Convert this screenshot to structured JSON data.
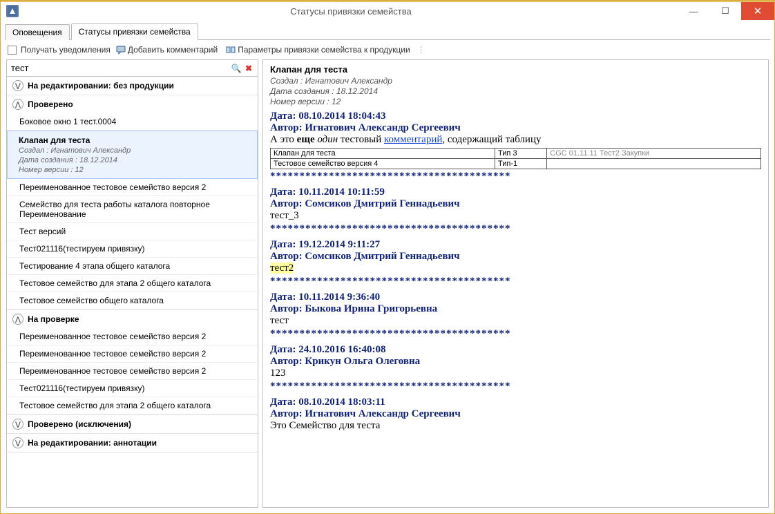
{
  "window": {
    "title": "Статусы привязки семейства"
  },
  "tabs": [
    {
      "label": "Оповещения",
      "active": false
    },
    {
      "label": "Статусы привязки семейства",
      "active": true
    }
  ],
  "toolbar": {
    "receive": "Получать уведомления",
    "comment": "Добавить комментарий",
    "params": "Параметры привязки семейства к продукции"
  },
  "search": {
    "value": "тест"
  },
  "groups": [
    {
      "title": "На редактировании: без продукции",
      "expanded": false,
      "items": []
    },
    {
      "title": "Проверено",
      "expanded": true,
      "items": [
        {
          "title": "Боковое окно 1 тест.0004"
        },
        {
          "title": "Клапан для теста",
          "selected": true,
          "meta": [
            "Создал :  Игнатович Александр",
            "Дата создания :  18.12.2014",
            "Номер версии :  12"
          ]
        },
        {
          "title": "Переименованное тестовое семейство версия 2"
        },
        {
          "title": "Семейство для теста работы каталога повторное Переименование"
        },
        {
          "title": "Тест версий"
        },
        {
          "title": "Тест021116(тестируем привязку)"
        },
        {
          "title": "Тестирование 4 этапа общего каталога"
        },
        {
          "title": "Тестовое семейство для этапа 2 общего каталога"
        },
        {
          "title": "Тестовое семейство общего каталога"
        }
      ]
    },
    {
      "title": "На проверке",
      "expanded": true,
      "items": [
        {
          "title": "Переименованное тестовое семейство версия 2"
        },
        {
          "title": "Переименованное тестовое семейство версия 2"
        },
        {
          "title": "Переименованное тестовое семейство версия 2"
        },
        {
          "title": "Тест021116(тестируем привязку)"
        },
        {
          "title": "Тестовое семейство для этапа 2 общего каталога"
        }
      ]
    },
    {
      "title": "Проверено (исключения)",
      "expanded": false,
      "items": []
    },
    {
      "title": "На редактировании: аннотации",
      "expanded": false,
      "items": []
    }
  ],
  "detail": {
    "title": "Клапан для теста",
    "meta": [
      "Создал :  Игнатович Александр",
      "Дата создания :  18.12.2014",
      "Номер версии :  12"
    ],
    "entries": [
      {
        "date": "Дата: 08.10.2014 18:04:43",
        "author": "Автор: Игнатович Александр Сергеевич",
        "body_html": "А это <b>еще</b> <i>один</i> тестовый <a href='#'>комментарий</a>, содержащий таблицу",
        "table": [
          [
            "Клапан для теста",
            "Тип 3",
            "CGC 01.11.11 Тест2 Закупки"
          ],
          [
            "Тестовое семейство версия 4",
            "Тип-1",
            ""
          ]
        ]
      },
      {
        "stars": true
      },
      {
        "date": "Дата: 10.11.2014 10:11:59",
        "author": "Автор: Сомсиков Дмитрий Геннадьевич",
        "body": "тест_3"
      },
      {
        "stars": true
      },
      {
        "date": "Дата: 19.12.2014 9:11:27",
        "author": "Автор: Сомсиков Дмитрий Геннадьевич",
        "body_hl": "тест2"
      },
      {
        "stars": true
      },
      {
        "date": "Дата: 10.11.2014 9:36:40",
        "author": "Автор: Быкова Ирина Григорьевна",
        "body": "тест"
      },
      {
        "stars": true
      },
      {
        "date": "Дата: 24.10.2016 16:40:08",
        "author": "Автор: Крикун Ольга Олеговна",
        "body": "123"
      },
      {
        "stars": true
      },
      {
        "date": "Дата: 08.10.2014 18:03:11",
        "author": "Автор: Игнатович Александр Сергеевич",
        "body": "Это Семейство для теста"
      }
    ],
    "stars_text": "*****************************************"
  }
}
